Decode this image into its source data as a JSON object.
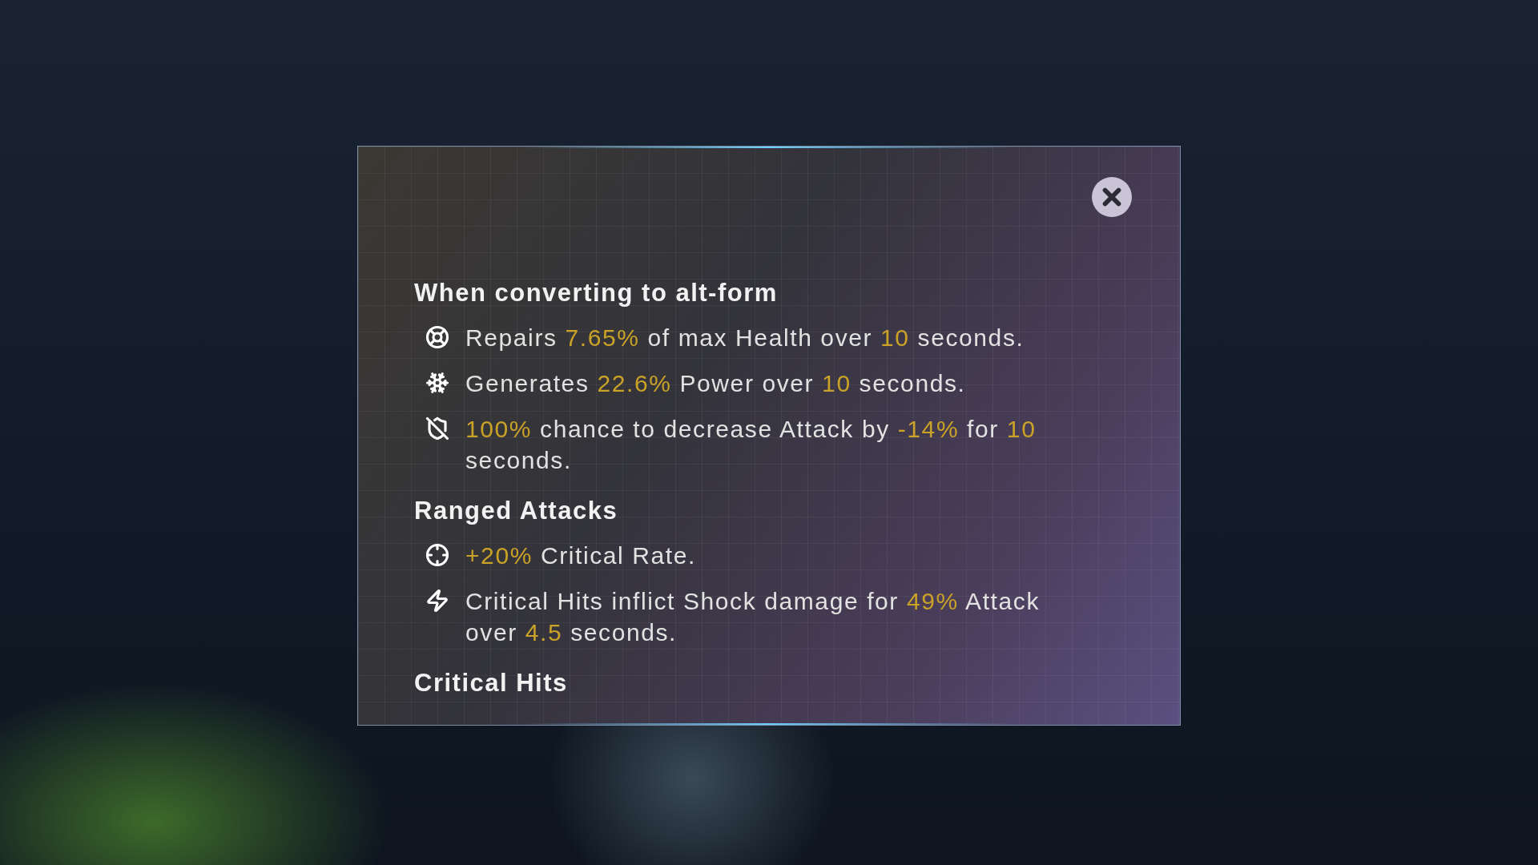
{
  "dialog": {
    "sections": [
      {
        "title": "When converting to alt-form",
        "effects": [
          {
            "kind": "repair",
            "parts": [
              {
                "text": "Repairs ",
                "highlight": false
              },
              {
                "text": "7.65%",
                "highlight": true
              },
              {
                "text": " of max Health over ",
                "highlight": false
              },
              {
                "text": "10",
                "highlight": true
              },
              {
                "text": " seconds.",
                "highlight": false
              }
            ]
          },
          {
            "kind": "power",
            "parts": [
              {
                "text": "Generates ",
                "highlight": false
              },
              {
                "text": "22.6%",
                "highlight": true
              },
              {
                "text": " Power over ",
                "highlight": false
              },
              {
                "text": "10",
                "highlight": true
              },
              {
                "text": " seconds.",
                "highlight": false
              }
            ]
          },
          {
            "kind": "debuff",
            "parts": [
              {
                "text": "100%",
                "highlight": true
              },
              {
                "text": " chance to decrease Attack by ",
                "highlight": false
              },
              {
                "text": "-14%",
                "highlight": true
              },
              {
                "text": " for ",
                "highlight": false
              },
              {
                "text": "10",
                "highlight": true
              },
              {
                "text": " seconds.",
                "highlight": false
              }
            ]
          }
        ]
      },
      {
        "title": "Ranged Attacks",
        "effects": [
          {
            "kind": "crit",
            "parts": [
              {
                "text": "+20%",
                "highlight": true
              },
              {
                "text": " Critical Rate.",
                "highlight": false
              }
            ]
          },
          {
            "kind": "shock",
            "parts": [
              {
                "text": "Critical Hits inflict Shock damage for ",
                "highlight": false
              },
              {
                "text": "49%",
                "highlight": true
              },
              {
                "text": " Attack over ",
                "highlight": false
              },
              {
                "text": "4.5",
                "highlight": true
              },
              {
                "text": " seconds.",
                "highlight": false
              }
            ]
          }
        ]
      },
      {
        "title": "Critical Hits"
      }
    ]
  }
}
